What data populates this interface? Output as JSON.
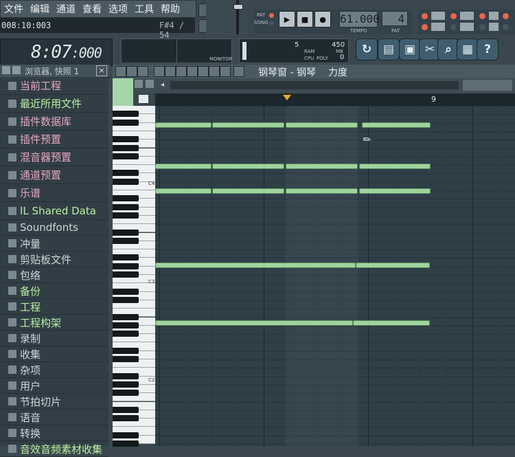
{
  "menu": [
    "文件",
    "编辑",
    "通道",
    "查看",
    "选项",
    "工具",
    "帮助"
  ],
  "hint": {
    "left": "008:10:003",
    "right": "F#4 / 54"
  },
  "transport": {
    "tempo": "61.000",
    "pattern": "4",
    "tempo_label": "TEMPO",
    "pat_label": "PAT",
    "pat_mode": "PAT",
    "song_mode": "SONG"
  },
  "clock": "8:07",
  "clock_small": ":000",
  "monitor": {
    "label": "MONITOR",
    "ram": "5",
    "poly": "0",
    "cpu_val": "450",
    "ram_label": "RAM",
    "cpu_label": "CPU",
    "poly_label": "POLY",
    "mb_label": "MB"
  },
  "browser": {
    "title": "浏览器, 快照 1",
    "items": [
      {
        "label": "当前工程",
        "tone": "pink"
      },
      {
        "label": "最近所用文件",
        "tone": "green"
      },
      {
        "label": "插件数据库",
        "tone": "pink"
      },
      {
        "label": "插件预置",
        "tone": "pink"
      },
      {
        "label": "混音器预置",
        "tone": "pink"
      },
      {
        "label": "通道预置",
        "tone": "pink"
      },
      {
        "label": "乐谱",
        "tone": "pink"
      },
      {
        "label": "IL Shared Data",
        "tone": "green"
      },
      {
        "label": "Soundfonts",
        "tone": "grey"
      },
      {
        "label": "冲量",
        "tone": "grey"
      },
      {
        "label": "剪贴板文件",
        "tone": "grey"
      },
      {
        "label": "包络",
        "tone": "grey"
      },
      {
        "label": "备份",
        "tone": "green"
      },
      {
        "label": "工程",
        "tone": "green"
      },
      {
        "label": "工程构架",
        "tone": "green"
      },
      {
        "label": "录制",
        "tone": "grey"
      },
      {
        "label": "收集",
        "tone": "grey"
      },
      {
        "label": "杂项",
        "tone": "grey"
      },
      {
        "label": "用户",
        "tone": "grey"
      },
      {
        "label": "节拍切片",
        "tone": "grey"
      },
      {
        "label": "语音",
        "tone": "grey"
      },
      {
        "label": "转换",
        "tone": "grey"
      },
      {
        "label": "音效音频素材收集",
        "tone": "green"
      }
    ]
  },
  "pianoroll": {
    "title": "钢琴窗 - 钢琴",
    "param": "力度",
    "bar_marker": "9",
    "key_labels": [
      "C4",
      "C3",
      "C2"
    ]
  },
  "colors": {
    "note": "#9ed39d",
    "accent_pink": "#e7a8c3",
    "accent_green": "#b9f0a0"
  }
}
